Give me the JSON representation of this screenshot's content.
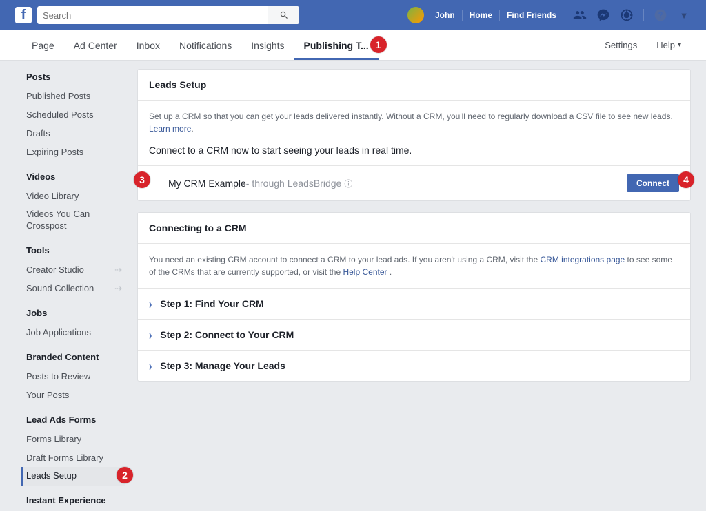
{
  "topbar": {
    "search_placeholder": "Search",
    "user_name": "John",
    "links": {
      "home": "Home",
      "find_friends": "Find Friends"
    }
  },
  "subnav": {
    "items": [
      "Page",
      "Ad Center",
      "Inbox",
      "Notifications",
      "Insights",
      "Publishing T..."
    ],
    "active_index": 5,
    "settings": "Settings",
    "help": "Help"
  },
  "sidebar": {
    "sections": [
      {
        "title": "Posts",
        "items": [
          "Published Posts",
          "Scheduled Posts",
          "Drafts",
          "Expiring Posts"
        ]
      },
      {
        "title": "Videos",
        "items": [
          "Video Library",
          "Videos You Can Crosspost"
        ]
      },
      {
        "title": "Tools",
        "items": [
          "Creator Studio",
          "Sound Collection"
        ],
        "external": [
          0,
          1
        ]
      },
      {
        "title": "Jobs",
        "items": [
          "Job Applications"
        ]
      },
      {
        "title": "Branded Content",
        "items": [
          "Posts to Review",
          "Your Posts"
        ]
      },
      {
        "title": "Lead Ads Forms",
        "items": [
          "Forms Library",
          "Draft Forms Library",
          "Leads Setup"
        ],
        "active_index": 2
      },
      {
        "title": "Instant Experience",
        "items": []
      }
    ]
  },
  "leads_card": {
    "title": "Leads Setup",
    "desc": "Set up a CRM so that you can get your leads delivered instantly. Without a CRM, you'll need to regularly download a CSV file to see new leads. ",
    "learn_more": "Learn more",
    "prompt": "Connect to a CRM now to start seeing your leads in real time.",
    "crm_name": "My CRM Example",
    "crm_sub": " - through LeadsBridge ",
    "connect": "Connect"
  },
  "connecting_card": {
    "title": "Connecting to a CRM",
    "desc1": "You need an existing CRM account to connect a CRM to your lead ads. If you aren't using a CRM, visit the ",
    "link1": "CRM integrations page",
    "desc2": " to see some of the CRMs that are currently supported, or visit the ",
    "link2": "Help Center",
    "desc3": " .",
    "steps": [
      "Step 1: Find Your CRM",
      "Step 2: Connect to Your CRM",
      "Step 3: Manage Your Leads"
    ]
  },
  "badges": {
    "b1": "1",
    "b2": "2",
    "b3": "3",
    "b4": "4"
  }
}
